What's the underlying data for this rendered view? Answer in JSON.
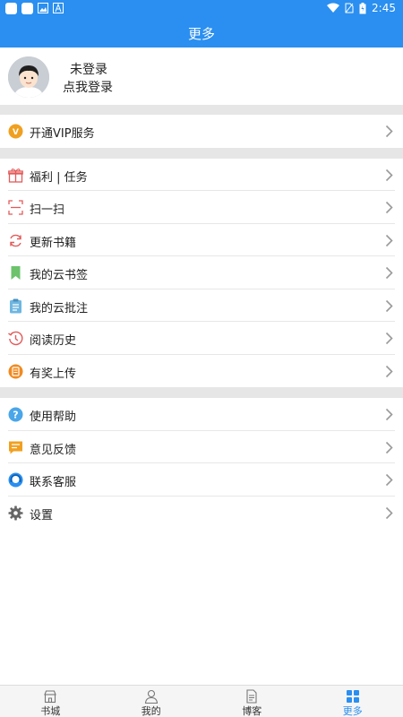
{
  "status_bar": {
    "time": "2:45"
  },
  "header": {
    "title": "更多"
  },
  "profile": {
    "name": "未登录",
    "login_prompt": "点我登录"
  },
  "groups": [
    {
      "items": [
        {
          "label": "开通VIP服务",
          "icon": "vip-icon",
          "color": "#f0a020"
        }
      ]
    },
    {
      "items": [
        {
          "label": "福利 | 任务",
          "icon": "gift-icon",
          "color": "#e35a5a"
        },
        {
          "label": "扫一扫",
          "icon": "scan-icon",
          "color": "#e35a5a"
        },
        {
          "label": "更新书籍",
          "icon": "refresh-icon",
          "color": "#e35a5a"
        },
        {
          "label": "我的云书签",
          "icon": "bookmark-icon",
          "color": "#6cc36c"
        },
        {
          "label": "我的云批注",
          "icon": "clipboard-icon",
          "color": "#6fb6e0"
        },
        {
          "label": "阅读历史",
          "icon": "history-icon",
          "color": "#e35a5a"
        },
        {
          "label": "有奖上传",
          "icon": "upload-icon",
          "color": "#f08a20"
        }
      ]
    },
    {
      "items": [
        {
          "label": "使用帮助",
          "icon": "help-icon",
          "color": "#4aa6e8"
        },
        {
          "label": "意见反馈",
          "icon": "feedback-icon",
          "color": "#f0a020"
        },
        {
          "label": "联系客服",
          "icon": "customer-service-icon",
          "color": "#2a8ff0"
        },
        {
          "label": "设置",
          "icon": "gear-icon",
          "color": "#666666"
        }
      ]
    }
  ],
  "tabs": [
    {
      "label": "书城",
      "icon": "bookstore-icon"
    },
    {
      "label": "我的",
      "icon": "user-icon"
    },
    {
      "label": "博客",
      "icon": "document-icon"
    },
    {
      "label": "更多",
      "icon": "grid-icon",
      "active": true
    }
  ],
  "colors": {
    "brand": "#2a8ff0",
    "section_gap": "#e6e6e6"
  }
}
